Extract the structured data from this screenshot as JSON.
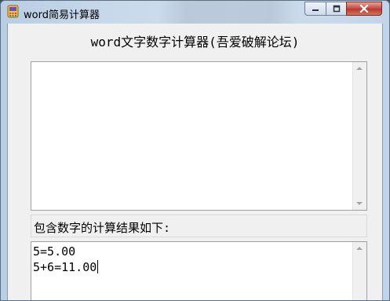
{
  "window": {
    "title": "word简易计算器"
  },
  "titlebar": {
    "minimize_glyph": "–",
    "maximize_glyph": "□",
    "close_glyph": "✕"
  },
  "main": {
    "heading": "word文字数字计算器(吾爱破解论坛)",
    "input_text": "",
    "result_label": "包含数字的计算结果如下:",
    "results": [
      "5=5.00",
      "5+6=11.00"
    ]
  },
  "colors": {
    "close_button": "#c75050",
    "client_background": "#f0f0f0"
  }
}
